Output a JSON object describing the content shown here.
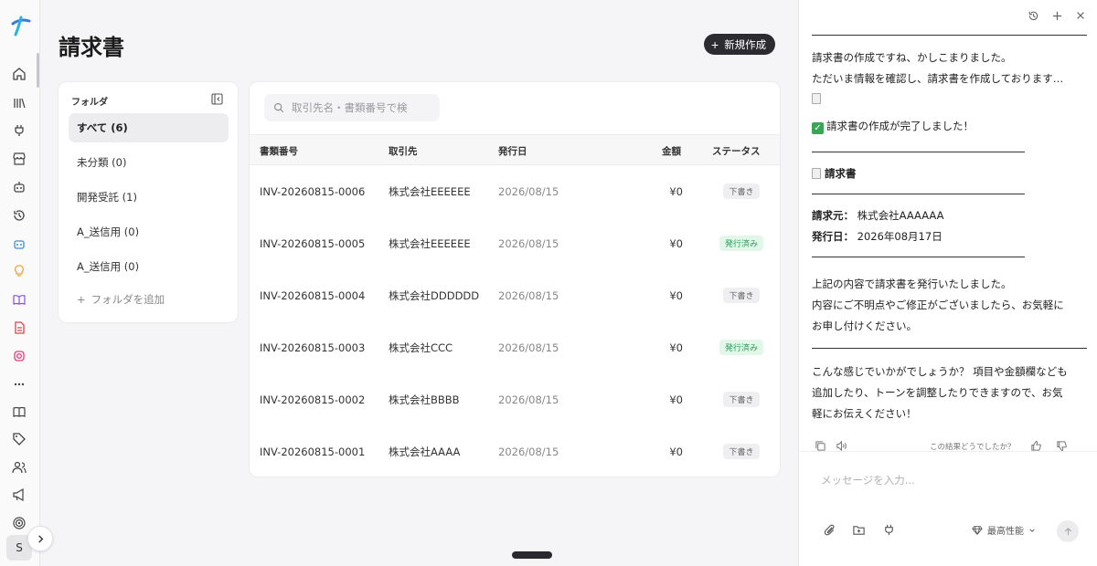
{
  "page": {
    "title": "請求書",
    "new_button_label": "新規作成"
  },
  "rail": {
    "avatar_initial": "S",
    "icons": [
      "home-icon",
      "library-icon",
      "plug-icon",
      "store-icon",
      "bot-icon",
      "history-icon",
      "assistant-icon",
      "lightbulb-icon",
      "book-icon",
      "document-icon",
      "instagram-icon",
      "more-icon",
      "guide-icon",
      "tag-icon",
      "users-icon",
      "megaphone-icon",
      "target-icon"
    ]
  },
  "folders": {
    "header": "フォルダ",
    "items": [
      {
        "label": "すべて (6)",
        "active": true
      },
      {
        "label": "未分類 (0)",
        "active": false
      },
      {
        "label": "開発受託 (1)",
        "active": false
      },
      {
        "label": "A_送信用 (0)",
        "active": false
      },
      {
        "label": "A_送信用 (0)",
        "active": false
      }
    ],
    "add_label": "フォルダを追加"
  },
  "search": {
    "placeholder": "取引先名・書類番号で検"
  },
  "table": {
    "columns": [
      "書類番号",
      "取引先",
      "発行日",
      "金額",
      "ステータス"
    ],
    "rows": [
      {
        "number": "INV-20260815-0006",
        "client": "株式会社EEEEEE",
        "date": "2026/08/15",
        "amount": "¥0",
        "status": "下書き",
        "status_type": "draft"
      },
      {
        "number": "INV-20260815-0005",
        "client": "株式会社EEEEEE",
        "date": "2026/08/15",
        "amount": "¥0",
        "status": "発行済み",
        "status_type": "issued"
      },
      {
        "number": "INV-20260815-0004",
        "client": "株式会社DDDDDD",
        "date": "2026/08/15",
        "amount": "¥0",
        "status": "下書き",
        "status_type": "draft"
      },
      {
        "number": "INV-20260815-0003",
        "client": "株式会社CCC",
        "date": "2026/08/15",
        "amount": "¥0",
        "status": "発行済み",
        "status_type": "issued"
      },
      {
        "number": "INV-20260815-0002",
        "client": "株式会社BBBB",
        "date": "2026/08/15",
        "amount": "¥0",
        "status": "下書き",
        "status_type": "draft"
      },
      {
        "number": "INV-20260815-0001",
        "client": "株式会社AAAA",
        "date": "2026/08/15",
        "amount": "¥0",
        "status": "下書き",
        "status_type": "draft"
      }
    ]
  },
  "chat": {
    "line1": "請求書の作成ですね、かしこまりました。",
    "line2": "ただいま情報を確認し、請求書を作成しております…",
    "done": "請求書の作成が完了しました！",
    "heading": "請求書",
    "from_label": "請求元：",
    "from_value": "株式会社AAAAAA",
    "date_label": "発行日：",
    "date_value": "2026年08月17日",
    "para1_l1": "上記の内容で請求書を発行いたしました。",
    "para1_l2": "内容にご不明点やご修正がございましたら、お気軽に",
    "para1_l3": "お申し付けください。",
    "para2_l1": "こんな感じでいかがでしょうか？ 項目や金額欄なども",
    "para2_l2": "追加したり、トーンを調整したりできますので、お気",
    "para2_l3": "軽にお伝えください！",
    "feedback_prompt": "この結果どうでしたか？",
    "input_placeholder": "メッセージを入力...",
    "model_label": "最高性能"
  },
  "colors": {
    "issued_badge": "#2f9a59",
    "primary_button": "#2c2c30",
    "check": "#3aa655"
  }
}
